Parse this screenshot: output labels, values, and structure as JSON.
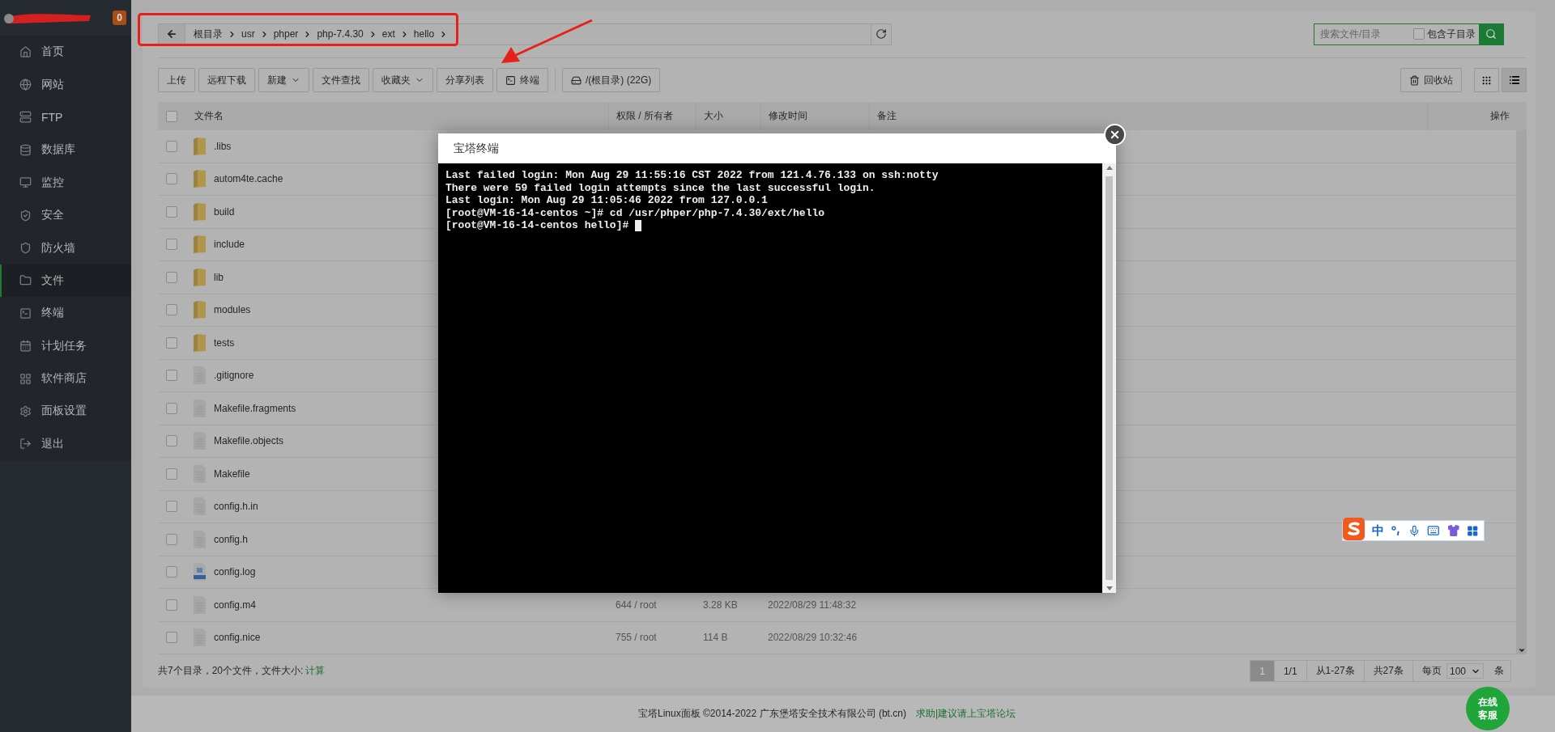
{
  "sidebar": {
    "badge": "0",
    "items": [
      {
        "label": "首页",
        "selected": false
      },
      {
        "label": "网站",
        "selected": false
      },
      {
        "label": "FTP",
        "selected": false
      },
      {
        "label": "数据库",
        "selected": false
      },
      {
        "label": "监控",
        "selected": false
      },
      {
        "label": "安全",
        "selected": false
      },
      {
        "label": "防火墙",
        "selected": false
      },
      {
        "label": "文件",
        "selected": true
      },
      {
        "label": "终端",
        "selected": false
      },
      {
        "label": "计划任务",
        "selected": false
      },
      {
        "label": "软件商店",
        "selected": false
      },
      {
        "label": "面板设置",
        "selected": false
      },
      {
        "label": "退出",
        "selected": false
      }
    ]
  },
  "breadcrumb": {
    "segments": [
      "根目录",
      "usr",
      "phper",
      "php-7.4.30",
      "ext",
      "hello"
    ]
  },
  "search": {
    "placeholder": "搜索文件/目录",
    "subdir_label": "包含子目录",
    "subdir_checked": false
  },
  "toolbar": {
    "buttons": [
      {
        "label": "上传",
        "kind": "plain"
      },
      {
        "label": "远程下载",
        "kind": "plain"
      },
      {
        "label": "新建",
        "kind": "dropdown"
      },
      {
        "label": "文件查找",
        "kind": "plain"
      },
      {
        "label": "收藏夹",
        "kind": "dropdown"
      },
      {
        "label": "分享列表",
        "kind": "plain"
      },
      {
        "label": "终端",
        "kind": "terminal"
      }
    ],
    "disk": "/(根目录) (22G)",
    "recycle": "回收站",
    "views": [
      {
        "kind": "grid",
        "selected": false
      },
      {
        "kind": "list",
        "selected": true
      }
    ]
  },
  "table": {
    "header_checked": false,
    "columns": [
      "文件名",
      "权限 / 所有者",
      "大小",
      "修改时间",
      "备注",
      "操作"
    ],
    "rows": [
      {
        "name": ".libs",
        "kind": "folder",
        "checked": false
      },
      {
        "name": "autom4te.cache",
        "kind": "folder",
        "checked": false
      },
      {
        "name": "build",
        "kind": "folder",
        "checked": false
      },
      {
        "name": "include",
        "kind": "folder",
        "checked": false
      },
      {
        "name": "lib",
        "kind": "folder",
        "checked": false
      },
      {
        "name": "modules",
        "kind": "folder",
        "checked": false
      },
      {
        "name": "tests",
        "kind": "folder",
        "checked": false
      },
      {
        "name": ".gitignore",
        "kind": "file",
        "checked": false
      },
      {
        "name": "Makefile.fragments",
        "kind": "file",
        "checked": false
      },
      {
        "name": "Makefile.objects",
        "kind": "file",
        "checked": false
      },
      {
        "name": "Makefile",
        "kind": "file",
        "checked": false
      },
      {
        "name": "config.h.in",
        "kind": "file",
        "checked": false
      },
      {
        "name": "config.h",
        "kind": "file",
        "checked": false
      },
      {
        "name": "config.log",
        "kind": "log",
        "checked": false
      },
      {
        "name": "config.m4",
        "kind": "file",
        "checked": false,
        "permission": "644 / root",
        "size": "3.28 KB",
        "modified": "2022/08/29 11:48:32"
      },
      {
        "name": "config.nice",
        "kind": "file",
        "checked": false,
        "permission": "755 / root",
        "size": "114 B",
        "modified": "2022/08/29 10:32:46"
      }
    ]
  },
  "summary": {
    "text": "共7个目录，20个文件，文件大小:",
    "link": "计算"
  },
  "pagination": {
    "pages": [
      {
        "label": "1",
        "selected": true
      }
    ],
    "page_count": "1/1",
    "range": "从1-27条",
    "total": "共27条",
    "per_page_label": "每页",
    "per_page": "100",
    "unit": "条"
  },
  "footer": {
    "copyright": "宝塔Linux面板 ©2014-2022 广东堡塔安全技术有限公司 (bt.cn)",
    "link": "求助|建议请上宝塔论坛"
  },
  "terminal_dialog": {
    "title": "宝塔终端",
    "lines": [
      "Last failed login: Mon Aug 29 11:55:16 CST 2022 from 121.4.76.133 on ssh:notty",
      "There were 59 failed login attempts since the last successful login.",
      "Last login: Mon Aug 29 11:05:46 2022 from 127.0.0.1",
      "[root@VM-16-14-centos ~]# cd /usr/phper/php-7.4.30/ext/hello",
      "[root@VM-16-14-centos hello]#"
    ]
  },
  "chat_button": {
    "label": "在线客服"
  },
  "ime_toolbar": {
    "mode": "中"
  }
}
